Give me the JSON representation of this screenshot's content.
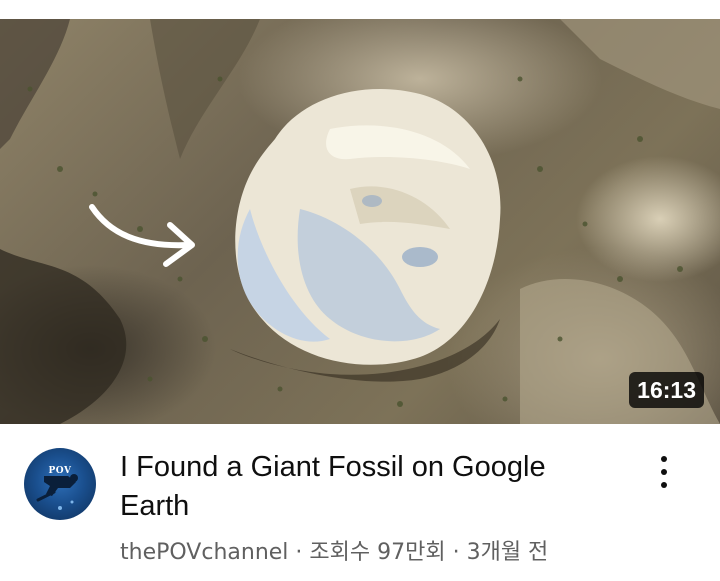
{
  "video": {
    "title": "I Found a Giant Fossil on Google Earth",
    "duration": "16:13",
    "channel": "thePOVchannel",
    "separator": " · ",
    "views": "조회수 97만회",
    "age": "3개월 전"
  },
  "avatar": {
    "text": "POV"
  },
  "icons": {
    "more": "more-vert-icon",
    "arrow": "curved-arrow-icon"
  },
  "colors": {
    "title": "#0f0f0f",
    "meta": "#606060",
    "badge_bg": "#000000",
    "badge_text": "#ffffff"
  }
}
